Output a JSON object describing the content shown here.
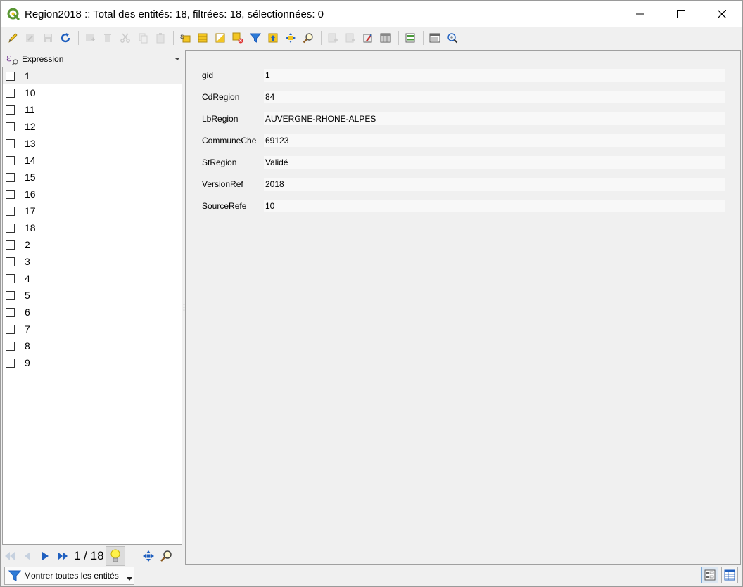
{
  "window": {
    "title": "Region2018 :: Total des entités: 18, filtrées: 18, sélectionnées: 0"
  },
  "toolbar": {
    "icons": [
      "pencil-icon",
      "save-edits-icon",
      "save-icon",
      "reload-icon",
      "add-feature-icon",
      "delete-feature-icon",
      "cut-icon",
      "copy-icon",
      "paste-icon",
      "select-by-expression-icon",
      "select-all-icon",
      "invert-selection-icon",
      "deselect-all-icon",
      "filter-icon",
      "move-selection-to-top-icon",
      "pan-to-selection-icon",
      "zoom-to-selection-icon",
      "new-field-icon",
      "delete-field-icon",
      "organize-columns-icon",
      "field-calculator-icon",
      "conditional-formatting-icon",
      "dock-icon",
      "actions-icon"
    ]
  },
  "list": {
    "header_label": "Expression",
    "items": [
      "1",
      "10",
      "11",
      "12",
      "13",
      "14",
      "15",
      "16",
      "17",
      "18",
      "2",
      "3",
      "4",
      "5",
      "6",
      "7",
      "8",
      "9"
    ],
    "selected_index": 0
  },
  "form": {
    "fields": [
      {
        "label": "gid",
        "value": "1"
      },
      {
        "label": "CdRegion",
        "value": "84"
      },
      {
        "label": "LbRegion",
        "value": "AUVERGNE-RHONE-ALPES"
      },
      {
        "label": "CommuneChe",
        "value": "69123"
      },
      {
        "label": "StRegion",
        "value": "Validé"
      },
      {
        "label": "VersionRef",
        "value": "2018"
      },
      {
        "label": "SourceRefe",
        "value": "10"
      }
    ]
  },
  "nav": {
    "counter": "1 / 18"
  },
  "bottom": {
    "filter_label": "Montrer toutes les entités"
  },
  "colors": {
    "accent_blue": "#1f5fbf",
    "qgis_green": "#589632",
    "yellow": "#f3c623"
  }
}
